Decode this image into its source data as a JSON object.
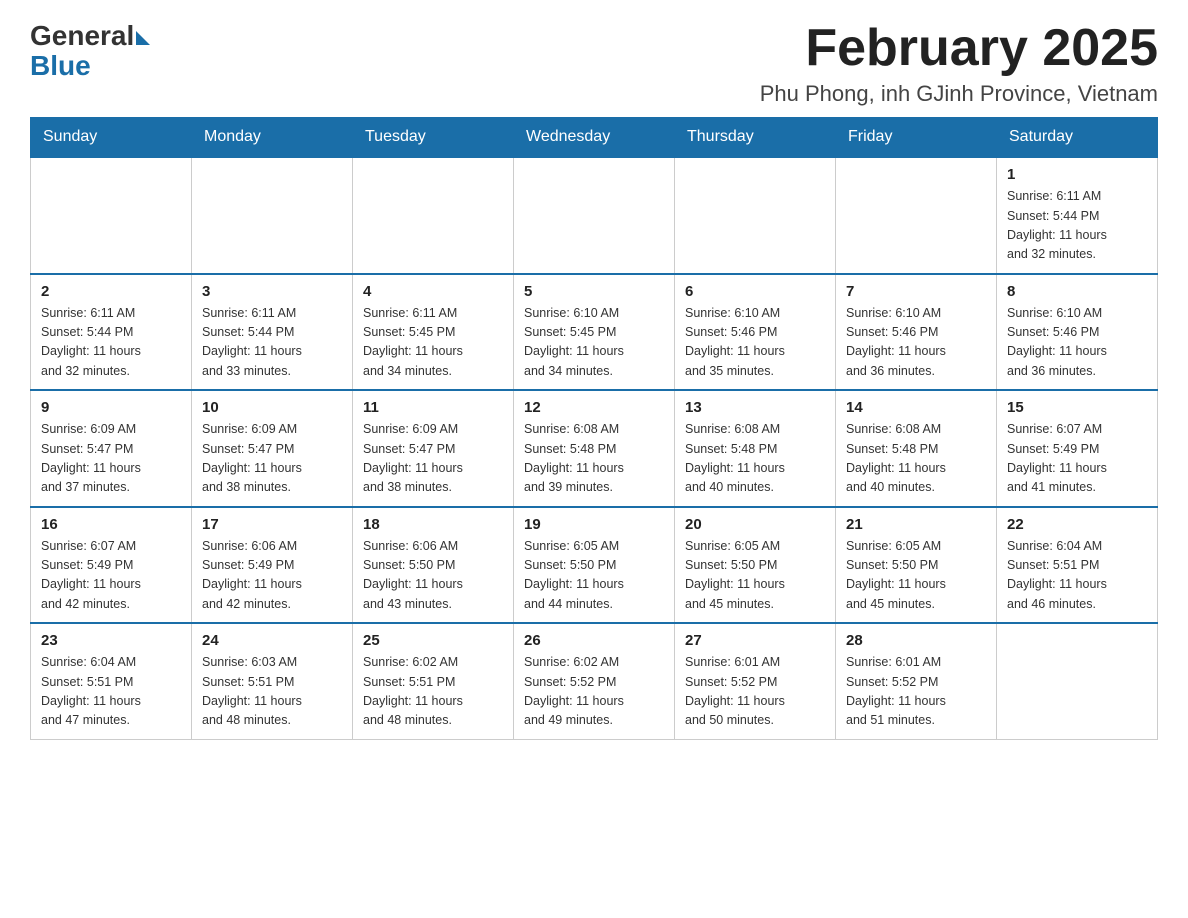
{
  "header": {
    "logo_general": "General",
    "logo_blue": "Blue",
    "main_title": "February 2025",
    "subtitle": "Phu Phong, inh GJinh Province, Vietnam"
  },
  "days_of_week": [
    "Sunday",
    "Monday",
    "Tuesday",
    "Wednesday",
    "Thursday",
    "Friday",
    "Saturday"
  ],
  "weeks": [
    [
      {
        "day": "",
        "info": ""
      },
      {
        "day": "",
        "info": ""
      },
      {
        "day": "",
        "info": ""
      },
      {
        "day": "",
        "info": ""
      },
      {
        "day": "",
        "info": ""
      },
      {
        "day": "",
        "info": ""
      },
      {
        "day": "1",
        "info": "Sunrise: 6:11 AM\nSunset: 5:44 PM\nDaylight: 11 hours\nand 32 minutes."
      }
    ],
    [
      {
        "day": "2",
        "info": "Sunrise: 6:11 AM\nSunset: 5:44 PM\nDaylight: 11 hours\nand 32 minutes."
      },
      {
        "day": "3",
        "info": "Sunrise: 6:11 AM\nSunset: 5:44 PM\nDaylight: 11 hours\nand 33 minutes."
      },
      {
        "day": "4",
        "info": "Sunrise: 6:11 AM\nSunset: 5:45 PM\nDaylight: 11 hours\nand 34 minutes."
      },
      {
        "day": "5",
        "info": "Sunrise: 6:10 AM\nSunset: 5:45 PM\nDaylight: 11 hours\nand 34 minutes."
      },
      {
        "day": "6",
        "info": "Sunrise: 6:10 AM\nSunset: 5:46 PM\nDaylight: 11 hours\nand 35 minutes."
      },
      {
        "day": "7",
        "info": "Sunrise: 6:10 AM\nSunset: 5:46 PM\nDaylight: 11 hours\nand 36 minutes."
      },
      {
        "day": "8",
        "info": "Sunrise: 6:10 AM\nSunset: 5:46 PM\nDaylight: 11 hours\nand 36 minutes."
      }
    ],
    [
      {
        "day": "9",
        "info": "Sunrise: 6:09 AM\nSunset: 5:47 PM\nDaylight: 11 hours\nand 37 minutes."
      },
      {
        "day": "10",
        "info": "Sunrise: 6:09 AM\nSunset: 5:47 PM\nDaylight: 11 hours\nand 38 minutes."
      },
      {
        "day": "11",
        "info": "Sunrise: 6:09 AM\nSunset: 5:47 PM\nDaylight: 11 hours\nand 38 minutes."
      },
      {
        "day": "12",
        "info": "Sunrise: 6:08 AM\nSunset: 5:48 PM\nDaylight: 11 hours\nand 39 minutes."
      },
      {
        "day": "13",
        "info": "Sunrise: 6:08 AM\nSunset: 5:48 PM\nDaylight: 11 hours\nand 40 minutes."
      },
      {
        "day": "14",
        "info": "Sunrise: 6:08 AM\nSunset: 5:48 PM\nDaylight: 11 hours\nand 40 minutes."
      },
      {
        "day": "15",
        "info": "Sunrise: 6:07 AM\nSunset: 5:49 PM\nDaylight: 11 hours\nand 41 minutes."
      }
    ],
    [
      {
        "day": "16",
        "info": "Sunrise: 6:07 AM\nSunset: 5:49 PM\nDaylight: 11 hours\nand 42 minutes."
      },
      {
        "day": "17",
        "info": "Sunrise: 6:06 AM\nSunset: 5:49 PM\nDaylight: 11 hours\nand 42 minutes."
      },
      {
        "day": "18",
        "info": "Sunrise: 6:06 AM\nSunset: 5:50 PM\nDaylight: 11 hours\nand 43 minutes."
      },
      {
        "day": "19",
        "info": "Sunrise: 6:05 AM\nSunset: 5:50 PM\nDaylight: 11 hours\nand 44 minutes."
      },
      {
        "day": "20",
        "info": "Sunrise: 6:05 AM\nSunset: 5:50 PM\nDaylight: 11 hours\nand 45 minutes."
      },
      {
        "day": "21",
        "info": "Sunrise: 6:05 AM\nSunset: 5:50 PM\nDaylight: 11 hours\nand 45 minutes."
      },
      {
        "day": "22",
        "info": "Sunrise: 6:04 AM\nSunset: 5:51 PM\nDaylight: 11 hours\nand 46 minutes."
      }
    ],
    [
      {
        "day": "23",
        "info": "Sunrise: 6:04 AM\nSunset: 5:51 PM\nDaylight: 11 hours\nand 47 minutes."
      },
      {
        "day": "24",
        "info": "Sunrise: 6:03 AM\nSunset: 5:51 PM\nDaylight: 11 hours\nand 48 minutes."
      },
      {
        "day": "25",
        "info": "Sunrise: 6:02 AM\nSunset: 5:51 PM\nDaylight: 11 hours\nand 48 minutes."
      },
      {
        "day": "26",
        "info": "Sunrise: 6:02 AM\nSunset: 5:52 PM\nDaylight: 11 hours\nand 49 minutes."
      },
      {
        "day": "27",
        "info": "Sunrise: 6:01 AM\nSunset: 5:52 PM\nDaylight: 11 hours\nand 50 minutes."
      },
      {
        "day": "28",
        "info": "Sunrise: 6:01 AM\nSunset: 5:52 PM\nDaylight: 11 hours\nand 51 minutes."
      },
      {
        "day": "",
        "info": ""
      }
    ]
  ]
}
